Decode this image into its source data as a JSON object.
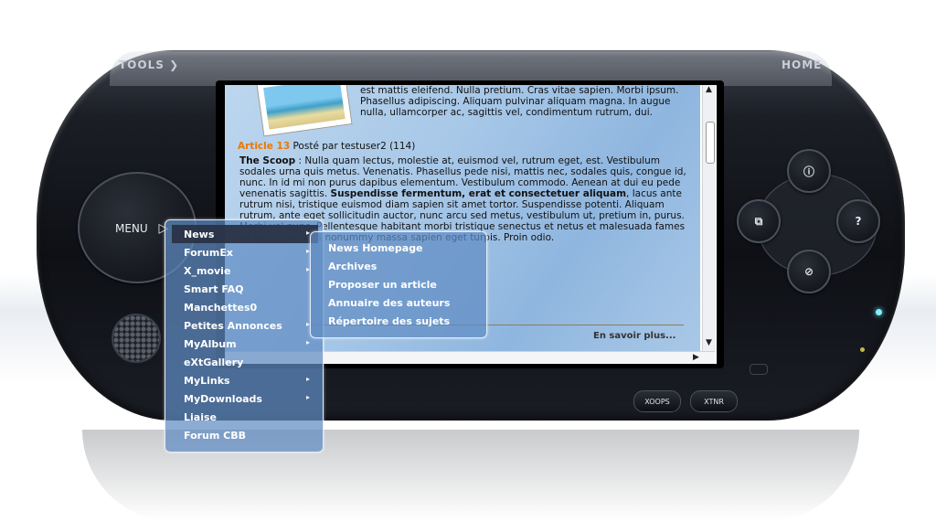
{
  "device": {
    "tools_label": "TOOLS",
    "home_label": "HOME",
    "menu_label": "MENU",
    "face_buttons": {
      "top": "ⓘ",
      "left": "⧉",
      "right": "?",
      "bottom": "⊘"
    },
    "bottom_buttons": [
      "XOOPS",
      "XTNR"
    ]
  },
  "screen": {
    "top_paragraph": "est mattis eleifend. Nulla pretium. Cras vitae sapien. Morbi ipsum. Phasellus adipiscing. Aliquam pulvinar aliquam magna. In augue nulla, ullamcorper ac, sagittis vel, condimentum rutrum, dui.",
    "article_link": "Article 13",
    "article_meta": " Posté par testuser2 (114)",
    "scoop_label": "The Scoop",
    "body_paragraph_1": " : Nulla quam lectus, molestie at, euismod vel, rutrum eget, est. Vestibulum sodales urna quis metus. Venenatis. Phasellus pede nisi, mattis nec, sodales quis, congue id, nunc. In id mi non purus dapibus elementum. Vestibulum commodo. Aenean at dui eu pede venenatis sagittis. ",
    "body_bold": "Suspendisse fermentum, erat et consectetuer aliquam",
    "body_paragraph_2": ", lacus ante rutrum nisi, tristique euismod diam sapien sit amet tortor. Suspendisse potenti. Aliquam rutrum, ante eget sollicitudin auctor, nunc arcu sed metus, vestibulum ut, pretium in, purus. Morbi vel nunc. Pellentesque habitant morbi tristique senectus et netus et malesuada fames ac turpis egestas nonummy massa sapien eget turpis. Proin odio.",
    "read_more": "En savoir plus..."
  },
  "main_menu": [
    {
      "label": "News",
      "has_submenu": true,
      "active": true
    },
    {
      "label": "ForumEx",
      "has_submenu": true
    },
    {
      "label": "X_movie",
      "has_submenu": true
    },
    {
      "label": "Smart FAQ",
      "has_submenu": false
    },
    {
      "label": "Manchettes0",
      "has_submenu": false
    },
    {
      "label": "Petites Annonces",
      "has_submenu": true
    },
    {
      "label": "MyAlbum",
      "has_submenu": true
    },
    {
      "label": "eXtGallery",
      "has_submenu": false
    },
    {
      "label": "MyLinks",
      "has_submenu": true
    },
    {
      "label": "MyDownloads",
      "has_submenu": true
    },
    {
      "label": "Liaise",
      "has_submenu": false
    },
    {
      "label": "Forum CBB",
      "has_submenu": false
    }
  ],
  "sub_menu": [
    "News Homepage",
    "Archives",
    "Proposer un article",
    "Annuaire des auteurs",
    "Répertoire des sujets"
  ],
  "icons": {
    "submenu_arrow": "▸",
    "scroll_up": "▲",
    "scroll_down": "▼",
    "scroll_right": "▶",
    "menu_arrow": "▷"
  },
  "colors": {
    "article_link": "#ee7700",
    "menu_bg": "#608cc4",
    "screen_bg": "#a8c8e8"
  }
}
